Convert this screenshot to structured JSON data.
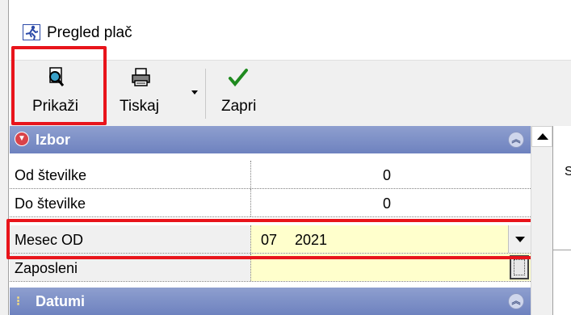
{
  "window": {
    "title": "Pregled plač"
  },
  "toolbar": {
    "show_label": "Prikaži",
    "print_label": "Tiskaj",
    "close_label": "Zapri"
  },
  "sections": {
    "izbor": "Izbor",
    "datumi": "Datumi"
  },
  "fields": {
    "od_stevilke": {
      "label": "Od številke",
      "value": "0"
    },
    "do_stevilke": {
      "label": "Do številke",
      "value": "0"
    },
    "mesec_od": {
      "label": "Mesec OD",
      "month": "07",
      "year": "2021"
    },
    "zaposleni": {
      "label": "Zaposleni",
      "value": ""
    }
  },
  "right_panel": {
    "partial_text": "S"
  },
  "colors": {
    "section_header": "#7b8dc6",
    "highlight": "#e8141b",
    "input_yellow": "#ffffcc"
  }
}
